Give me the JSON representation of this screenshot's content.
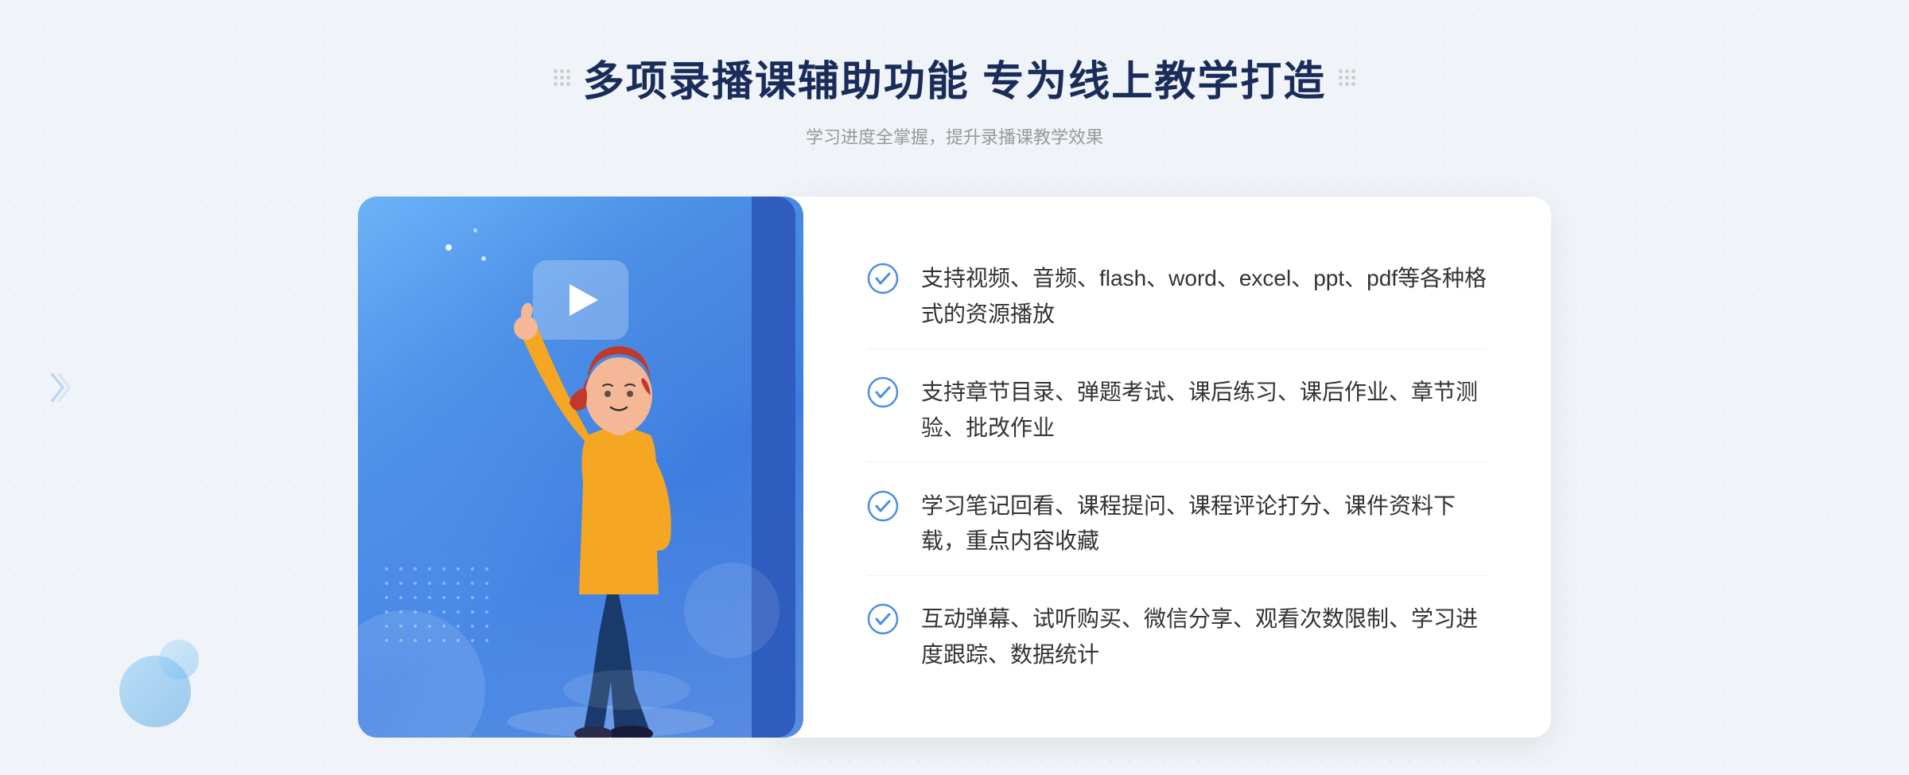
{
  "header": {
    "title": "多项录播课辅助功能 专为线上教学打造",
    "subtitle": "学习进度全掌握，提升录播课教学效果",
    "left_dots_label": "decorative-dots-left",
    "right_dots_label": "decorative-dots-right"
  },
  "features": [
    {
      "id": 1,
      "text": "支持视频、音频、flash、word、excel、ppt、pdf等各种格式的资源播放"
    },
    {
      "id": 2,
      "text": "支持章节目录、弹题考试、课后练习、课后作业、章节测验、批改作业"
    },
    {
      "id": 3,
      "text": "学习笔记回看、课程提问、课程评论打分、课件资料下载，重点内容收藏"
    },
    {
      "id": 4,
      "text": "互动弹幕、试听购买、微信分享、观看次数限制、学习进度跟踪、数据统计"
    }
  ],
  "colors": {
    "primary_blue": "#3a7de0",
    "dark_blue": "#1a2d5a",
    "check_color": "#4a90e2",
    "text_main": "#333333",
    "text_sub": "#999999"
  }
}
